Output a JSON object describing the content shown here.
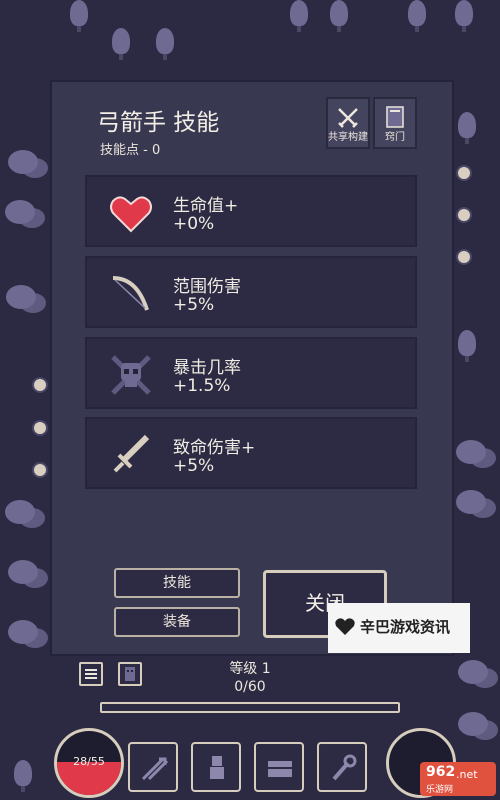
{
  "panel": {
    "title": "弓箭手 技能",
    "skill_points": "技能点 - 0",
    "share_build_label": "共享构建",
    "tips_label": "窍门"
  },
  "skills": [
    {
      "name": "生命值+",
      "value": "+0%",
      "icon": "heart-icon"
    },
    {
      "name": "范围伤害",
      "value": "+5%",
      "icon": "bow-icon"
    },
    {
      "name": "暴击几率",
      "value": "+1.5%",
      "icon": "skull-crossbones-icon"
    },
    {
      "name": "致命伤害+",
      "value": "+5%",
      "icon": "sword-icon"
    }
  ],
  "buttons": {
    "skills": "技能",
    "equipment": "装备",
    "close": "关闭"
  },
  "hud": {
    "level": "等级 1",
    "xp": "0/60",
    "xp_progress": 0,
    "hp": "28/55",
    "hp_fraction": 0.51
  },
  "watermark": {
    "text": "辛巴游戏资讯",
    "logo_number": "962",
    "logo_net": ".net",
    "logo_sub": "乐游网"
  },
  "colors": {
    "panel_bg": "#393851",
    "card_bg": "#2c2b43",
    "heart": "#e03a4a",
    "text": "#f1ece3"
  }
}
